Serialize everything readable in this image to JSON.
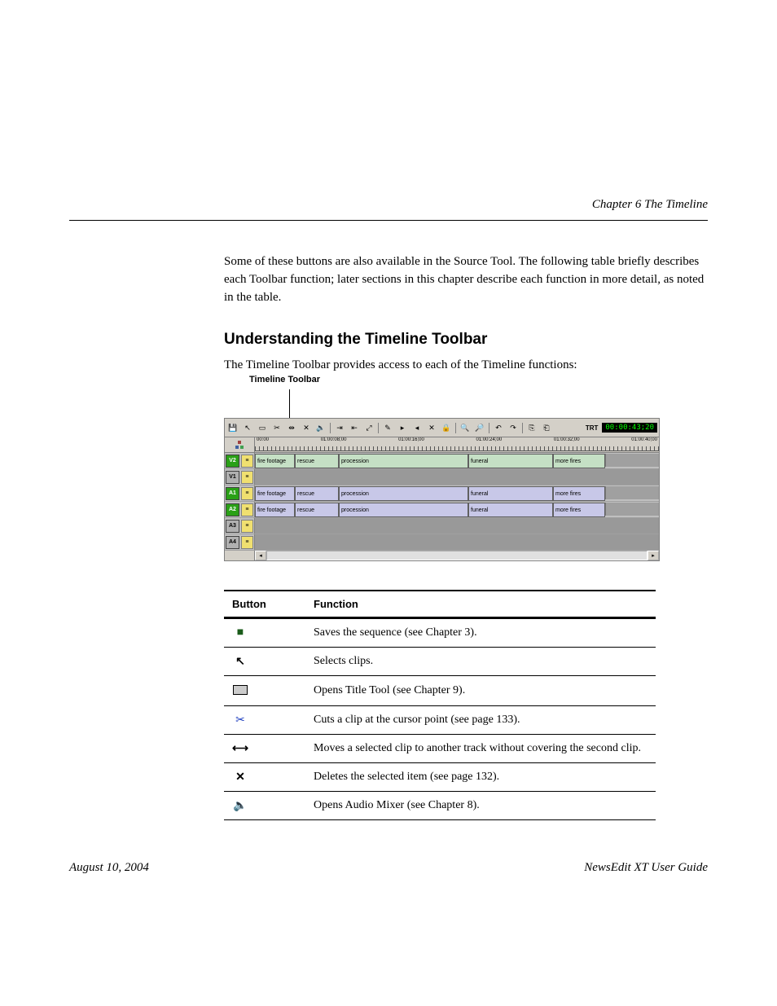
{
  "header": {
    "title": "Chapter 6   The Timeline"
  },
  "text": {
    "para1": "Some of these buttons are also available in the Source Tool. The following table briefly describes each Toolbar function; later sections in this chapter describe each function in more detail, as noted in the table.",
    "section_title": "Understanding the Timeline Toolbar",
    "para2": "The Timeline Toolbar provides access to each of the Timeline functions:",
    "callout": "Timeline Toolbar"
  },
  "toolbar_icons": [
    "save-icon",
    "arrow-icon",
    "cut-mode-icon",
    "splice-icon",
    "trim-icon",
    "delete-x-icon",
    "audio-icon",
    "sep",
    "input-tools-icon",
    "output-tools-icon",
    "fit-icon",
    "sep",
    "fx-icon",
    "mark-in-icon",
    "mark-out-icon",
    "x-icon",
    "lock-icon",
    "sep",
    "zoom-in-icon",
    "zoom-out-icon",
    "sep",
    "undo-icon",
    "redo-icon",
    "sep",
    "send-icon",
    "assign-icon"
  ],
  "trt": {
    "label": "TRT",
    "value": "00:00:43;20"
  },
  "ruler": [
    "00:00",
    "01:00:08;00",
    "01:00:16;00",
    "01:00:24;00",
    "01:00:32;00",
    "01:00:40;00"
  ],
  "tracks": [
    {
      "label": "V2",
      "active": true,
      "clips": [
        "fire footage",
        "rescue",
        "procession",
        "funeral",
        "more fires"
      ],
      "class": "green"
    },
    {
      "label": "V1",
      "active": false,
      "clips": []
    },
    {
      "label": "A1",
      "active": true,
      "clips": [
        "fire footage",
        "rescue",
        "procession",
        "funeral",
        "more fires"
      ],
      "class": "blue"
    },
    {
      "label": "A2",
      "active": true,
      "clips": [
        "fire footage",
        "rescue",
        "procession",
        "funeral",
        "more fires"
      ],
      "class": "blue"
    },
    {
      "label": "A3",
      "active": false,
      "clips": []
    },
    {
      "label": "A4",
      "active": false,
      "clips": []
    }
  ],
  "clip_widths": [
    45,
    50,
    155,
    100,
    60
  ],
  "table": {
    "headers": [
      "Button",
      "Function"
    ],
    "rows": [
      {
        "icon": "save",
        "desc": "Saves the sequence (see Chapter 3)."
      },
      {
        "icon": "arrow",
        "desc": "Selects clips."
      },
      {
        "icon": "title",
        "desc": "Opens Title Tool (see Chapter 9)."
      },
      {
        "icon": "cut",
        "desc": "Cuts a clip at the cursor point (see page 133)."
      },
      {
        "icon": "splice",
        "desc": "Moves a selected clip to another track without covering the second clip."
      },
      {
        "icon": "delete",
        "desc": "Deletes the selected item (see page 132)."
      },
      {
        "icon": "mixer",
        "desc": "Opens Audio Mixer (see Chapter 8)."
      }
    ]
  },
  "icons": {
    "save": "💾",
    "arrow": "➤",
    "title": "▭",
    "cut": "✂",
    "splice": "⟷",
    "delete": "✕",
    "mixer": "🔊"
  },
  "footer": {
    "date": "August 10, 2004",
    "product": "NewsEdit XT User Guide"
  }
}
